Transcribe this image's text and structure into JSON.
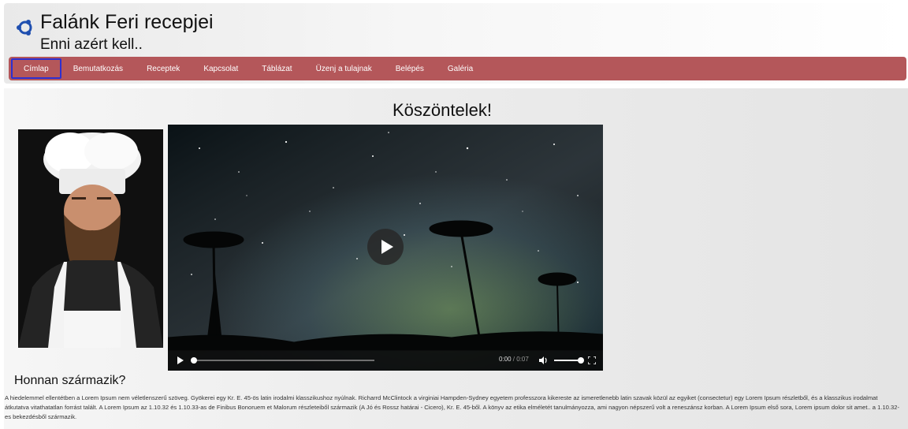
{
  "header": {
    "title": "Falánk Feri recepjei",
    "subtitle": "Enni azért kell..",
    "logo_icon": "ubuntu-logo-icon",
    "accent_color": "#b4575a"
  },
  "nav": {
    "items": [
      {
        "label": "Címlap",
        "active": true
      },
      {
        "label": "Bemutatkozás"
      },
      {
        "label": "Receptek"
      },
      {
        "label": "Kapcsolat"
      },
      {
        "label": "Táblázat"
      },
      {
        "label": "Üzenj a tulajnak"
      },
      {
        "label": "Belépés"
      },
      {
        "label": "Galéria"
      }
    ]
  },
  "main": {
    "heading": "Köszöntelek!",
    "video": {
      "current_time": "0:00",
      "separator": " / ",
      "duration": "0:07",
      "progress": 0.0,
      "volume": 1.0
    },
    "section_title": "Honnan származik?",
    "section_text": "A hiedelemmel ellentétben a Lorem Ipsum nem véletlenszerű szöveg. Gyökerei egy Kr. E. 45-ös latin irodalmi klasszikushoz nyúlnak. Richarrd McClintock a virginiai Hampden-Sydney egyetem professzora kikereste az ismeretlenebb latin szavak közül az egyiket (consectetur) egy Lorem Ipsum részletből, és a klasszikus irodalmat átkutatva vitathatatlan forrást talált. A Lorem Ipsum az 1.10.32 és 1.10.33-as de Finibus Bonoruem et Malorum részleteiből származik (A Jó és Rossz határai - Cicero), Kr. E. 45-ből. A könyv az etika elméletét tanulmányozza, ami nagyon népszerű volt a reneszánsz korban. A Lorem Ipsum első sora, Lorem ipsum dolor sit amet.. a 1.10.32-es bekezdésből származik."
  }
}
